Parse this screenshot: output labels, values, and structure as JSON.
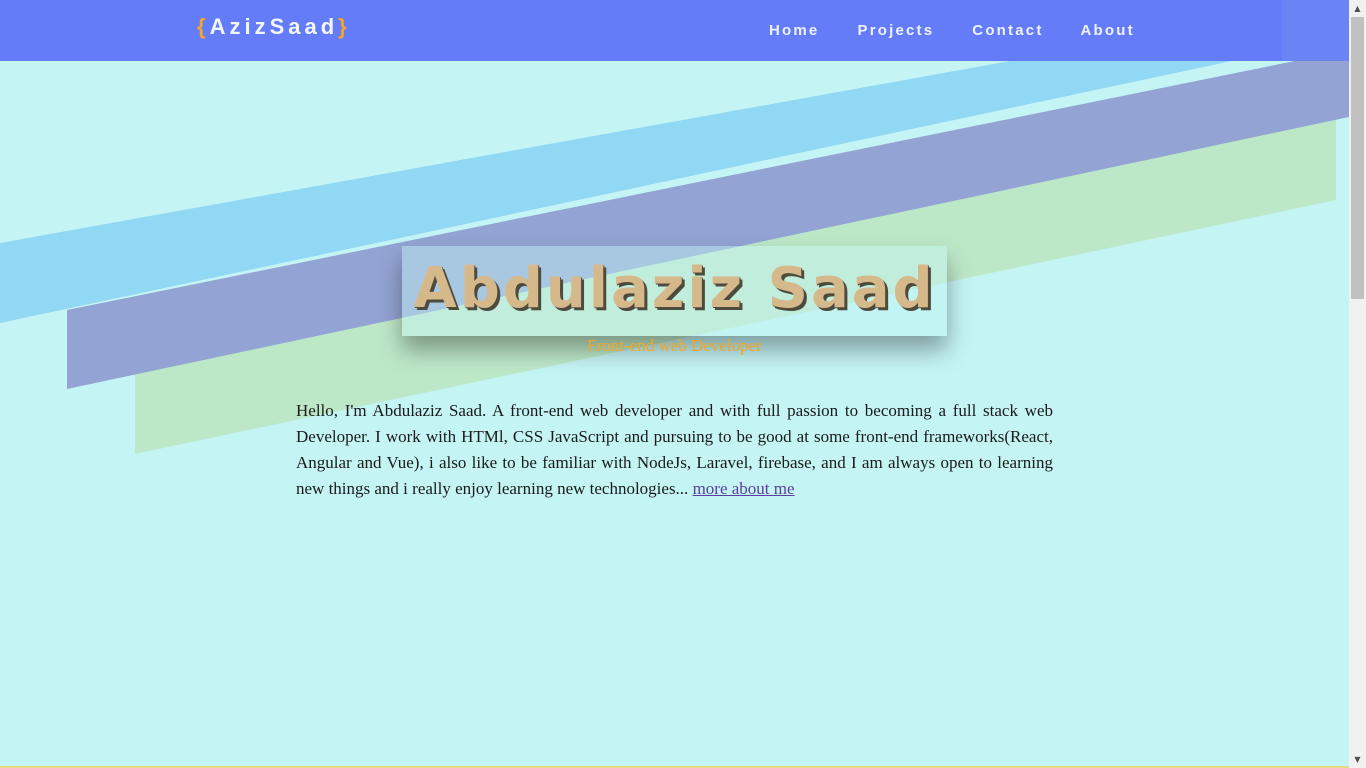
{
  "nav": {
    "logo_open": "{",
    "logo_text": "AzizSaad",
    "logo_close": "}",
    "links": [
      {
        "label": "Home"
      },
      {
        "label": "Projects"
      },
      {
        "label": "Contact"
      },
      {
        "label": "About"
      }
    ]
  },
  "hero": {
    "name": "Abdulaziz Saad",
    "subtitle": "Front-end web Developer"
  },
  "intro": {
    "text": "Hello, I'm Abdulaziz Saad. A front-end web developer and with full passion to becoming a full stack web Developer. I work with HTMl, CSS JavaScript and pursuing to be good at some front-end frameworks(React, Angular and Vue), i also like to be familiar with NodeJs, Laravel, firebase, and I am always open to learning new things and i really enjoy learning new technologies... ",
    "link_label": "more about me"
  },
  "colors": {
    "page_bg": "#c4f4f4",
    "navbar": "#647cf8",
    "accent": "#f5a623",
    "stripe_blue": "#8ed6f4",
    "stripe_purple": "#93a4d4",
    "stripe_green": "#bde8c8"
  },
  "icons": {
    "scroll_up": "triangle-up-icon",
    "scroll_down": "triangle-down-icon"
  }
}
